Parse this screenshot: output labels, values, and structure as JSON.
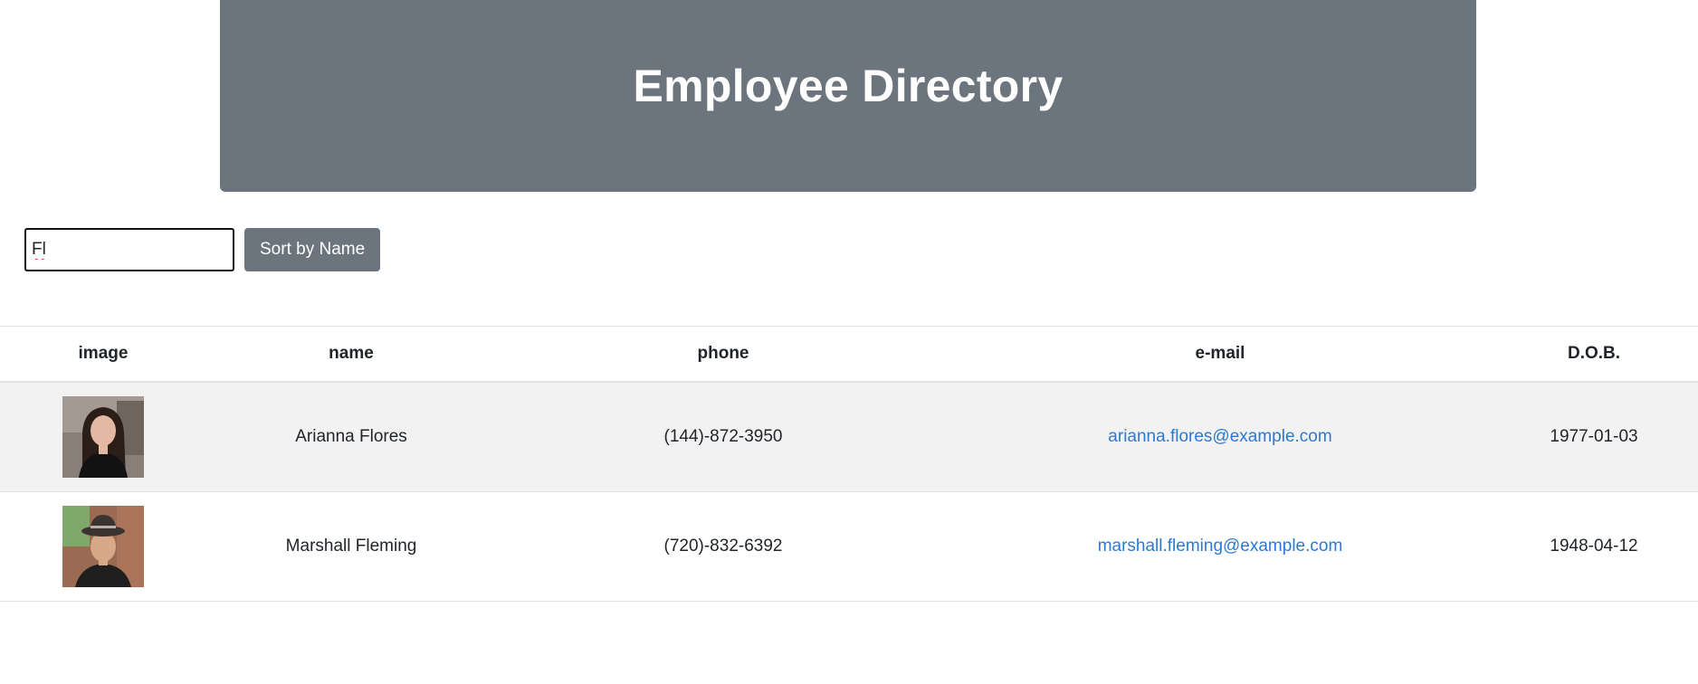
{
  "header": {
    "title": "Employee Directory"
  },
  "controls": {
    "search_value": "Fl",
    "sort_button_label": "Sort by Name"
  },
  "table": {
    "columns": [
      "image",
      "name",
      "phone",
      "e-mail",
      "D.O.B."
    ],
    "rows": [
      {
        "name": "Arianna Flores",
        "phone": "(144)-872-3950",
        "email": "arianna.flores@example.com",
        "dob": "1977-01-03"
      },
      {
        "name": "Marshall Fleming",
        "phone": "(720)-832-6392",
        "email": "marshall.fleming@example.com",
        "dob": "1948-04-12"
      }
    ]
  },
  "colors": {
    "header_bg": "#6c757d",
    "button_bg": "#6c757d",
    "link": "#2a7ad4",
    "stripe": "#f2f2f2"
  }
}
